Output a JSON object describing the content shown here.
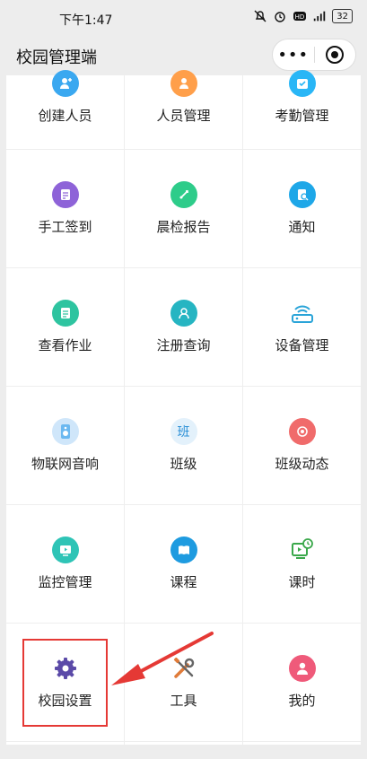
{
  "status_bar": {
    "time": "下午1:47",
    "battery": "32"
  },
  "nav": {
    "title": "校园管理端",
    "more_label": "•••"
  },
  "items": [
    {
      "label": "创建人员",
      "icon": "add-person-icon",
      "color": "#3aa8f0"
    },
    {
      "label": "人员管理",
      "icon": "people-icon",
      "color": "#ff9f4a"
    },
    {
      "label": "考勤管理",
      "icon": "attendance-icon",
      "color": "#29b6f6"
    },
    {
      "label": "手工签到",
      "icon": "sign-in-icon",
      "color": "#8e63d8"
    },
    {
      "label": "晨检报告",
      "icon": "morning-check-icon",
      "color": "#2ecc8a"
    },
    {
      "label": "通知",
      "icon": "notice-icon",
      "color": "#1ea7e8"
    },
    {
      "label": "查看作业",
      "icon": "homework-icon",
      "color": "#2ec4a0"
    },
    {
      "label": "注册查询",
      "icon": "register-search-icon",
      "color": "#26b5c2"
    },
    {
      "label": "设备管理",
      "icon": "router-icon",
      "color": "#2aa4d8"
    },
    {
      "label": "物联网音响",
      "icon": "speaker-icon",
      "color": "#6bb8f0"
    },
    {
      "label": "班级",
      "icon": "class-icon",
      "color": "#dff0fb",
      "glyph": "班"
    },
    {
      "label": "班级动态",
      "icon": "class-dynamics-icon",
      "color": "#f06b6b"
    },
    {
      "label": "监控管理",
      "icon": "monitor-icon",
      "color": "#2ec4b6"
    },
    {
      "label": "课程",
      "icon": "course-book-icon",
      "color": "#1e9be0"
    },
    {
      "label": "课时",
      "icon": "class-hour-icon",
      "color": "#3aa84a"
    },
    {
      "label": "校园设置",
      "icon": "gear-icon",
      "color": "#5b4aa8"
    },
    {
      "label": "工具",
      "icon": "tools-icon",
      "color": "#e07b39"
    },
    {
      "label": "我的",
      "icon": "profile-icon",
      "color": "#ef5a7a"
    }
  ]
}
